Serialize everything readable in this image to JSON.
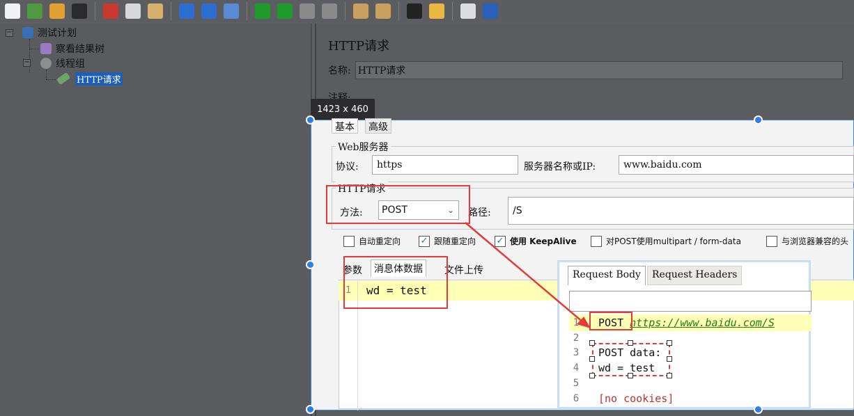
{
  "toolbar": {
    "buttons": [
      {
        "icon": "new-file-icon",
        "color": "#f2f2f2"
      },
      {
        "icon": "templates-icon",
        "color": "#4f9a3e"
      },
      {
        "icon": "open-icon",
        "color": "#e0a12f"
      },
      {
        "icon": "save-icon",
        "color": "#2a2a2a"
      },
      {
        "icon": "cut-icon",
        "color": "#c9382f"
      },
      {
        "icon": "copy-icon",
        "color": "#d8d8d8"
      },
      {
        "icon": "paste-icon",
        "color": "#d6b06c"
      },
      {
        "icon": "expand-icon",
        "color": "#2c6fd1"
      },
      {
        "icon": "collapse-icon",
        "color": "#2c6fd1"
      },
      {
        "icon": "toggle-icon",
        "color": "#5a8cd6"
      },
      {
        "icon": "start-icon",
        "color": "#1f9b2a"
      },
      {
        "icon": "start-no-pause-icon",
        "color": "#1f9b2a"
      },
      {
        "icon": "stop-icon",
        "color": "#8a8a8a"
      },
      {
        "icon": "shutdown-icon",
        "color": "#8a8a8a"
      },
      {
        "icon": "clear-icon",
        "color": "#c8a060"
      },
      {
        "icon": "clear-all-icon",
        "color": "#c8a060"
      },
      {
        "icon": "search-icon",
        "color": "#222222"
      },
      {
        "icon": "reset-search-icon",
        "color": "#e8b840"
      },
      {
        "icon": "function-helper-icon",
        "color": "#dddddd"
      },
      {
        "icon": "help-icon",
        "color": "#2c5fb8"
      }
    ]
  },
  "tree": {
    "test_plan": "测试计划",
    "view_results_tree": "察看结果树",
    "thread_group": "线程组",
    "http_request": "HTTP请求"
  },
  "panel": {
    "title": "HTTP请求",
    "name_label": "名称:",
    "name_value": "HTTP请求",
    "comment_label": "注释:"
  },
  "size_tooltip": "1423 x 460",
  "tabs": {
    "basic": "基本",
    "advanced": "高级"
  },
  "web_server": {
    "group_title": "Web服务器",
    "protocol_label": "协议:",
    "protocol_value": "https",
    "server_label": "服务器名称或IP:",
    "server_value": "www.baidu.com"
  },
  "http_request": {
    "group_title": "HTTP请求",
    "method_label": "方法:",
    "method_value": "POST",
    "path_label": "路径:",
    "path_value": "/S"
  },
  "checkboxes": [
    {
      "label": "自动重定向",
      "checked": false
    },
    {
      "label": "跟随重定向",
      "checked": true
    },
    {
      "label": "使用 KeepAlive",
      "checked": true
    },
    {
      "label": "对POST使用multipart / form-data",
      "checked": false
    },
    {
      "label": "与浏览器兼容的头",
      "checked": false
    }
  ],
  "body_tabs": {
    "params": "参数",
    "body_data": "消息体数据",
    "file_upload": "文件上传"
  },
  "editor": {
    "line_number": "1",
    "content": "wd = test"
  },
  "popup": {
    "tab_request_body": "Request Body",
    "tab_request_headers": "Request Headers",
    "lines": [
      {
        "n": "1",
        "method": "POST",
        "url": "https://www.baidu.com/S"
      },
      {
        "n": "2",
        "text": ""
      },
      {
        "n": "3",
        "text": "POST data:"
      },
      {
        "n": "4",
        "text": "wd = test"
      },
      {
        "n": "5",
        "text": ""
      },
      {
        "n": "6",
        "text": "[no cookies]"
      }
    ]
  },
  "colors": {
    "annotation_red": "#e53a3a",
    "selection_blue": "#2f7de6",
    "highlight_yellow": "#ffffb6"
  }
}
